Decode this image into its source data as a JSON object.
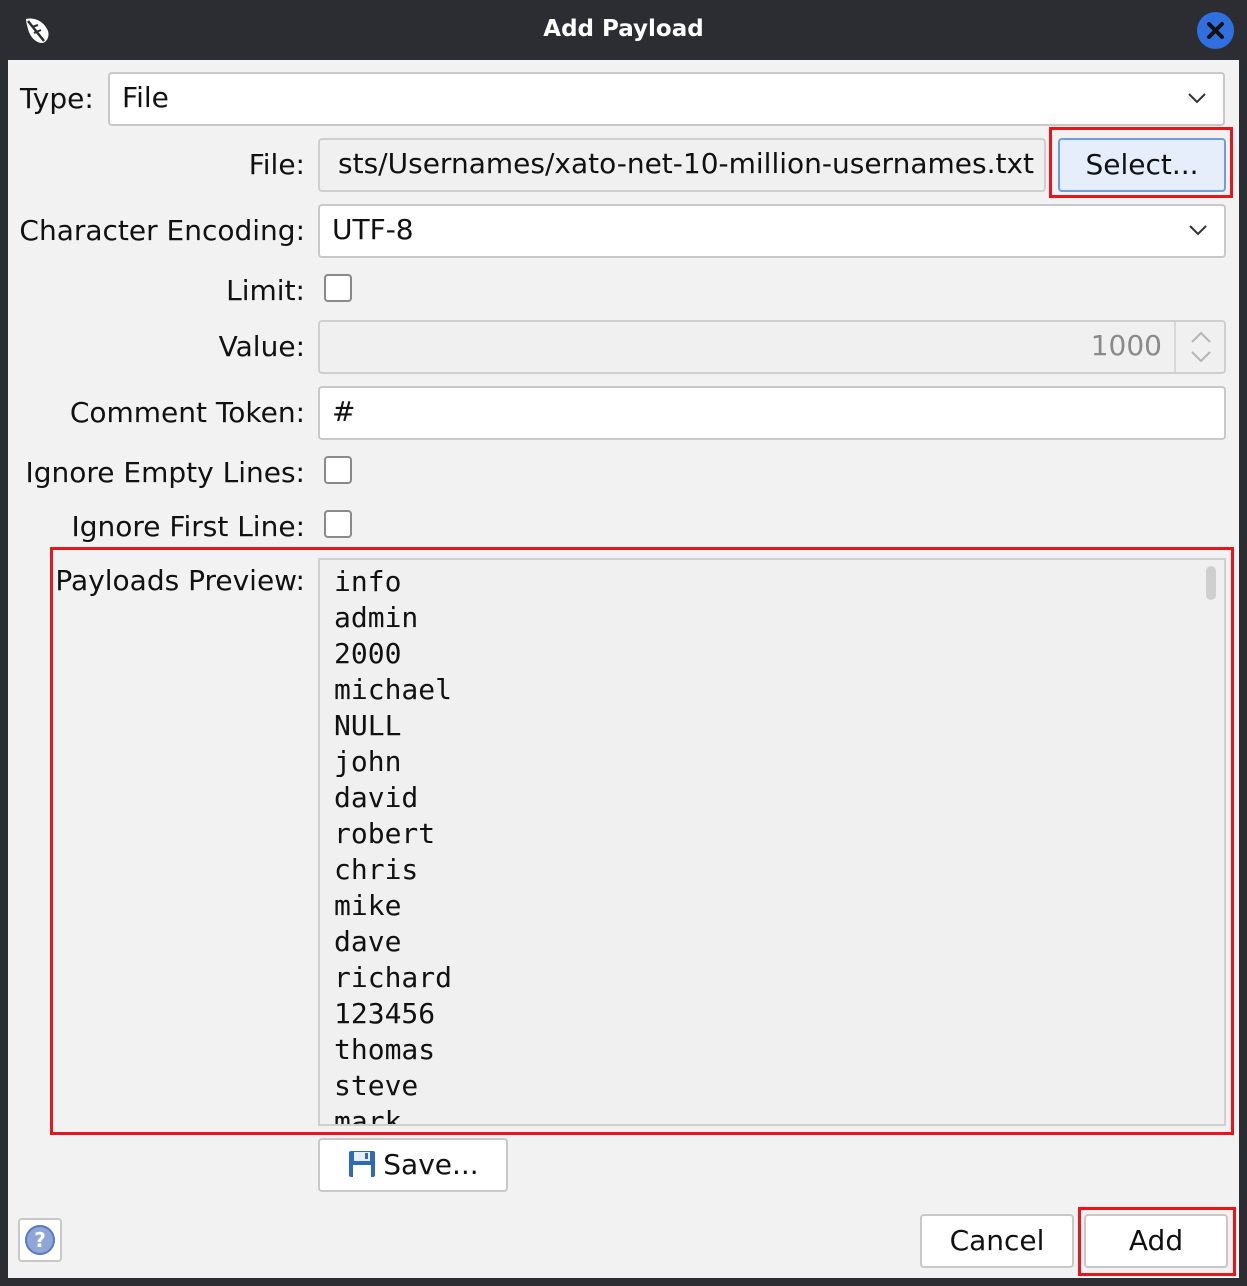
{
  "window": {
    "title": "Add Payload"
  },
  "icons": {
    "app": "app-feather-icon",
    "close": "close-icon",
    "chevron": "chevron-down-icon",
    "save": "floppy-disk-icon",
    "help": "help-icon",
    "spinner": "spinner-arrows-icon"
  },
  "form": {
    "type_label": "Type:",
    "type_value": "File",
    "file_label": "File:",
    "file_value": "sts/Usernames/xato-net-10-million-usernames.txt",
    "select_button": "Select...",
    "encoding_label": "Character Encoding:",
    "encoding_value": "UTF-8",
    "limit_label": "Limit:",
    "limit_checked": false,
    "value_label": "Value:",
    "value_value": "1000",
    "comment_label": "Comment Token:",
    "comment_value": "#",
    "ignore_empty_label": "Ignore Empty Lines:",
    "ignore_empty_checked": false,
    "ignore_first_label": "Ignore First Line:",
    "ignore_first_checked": false,
    "preview_label": "Payloads Preview:",
    "preview_items": [
      "info",
      "admin",
      "2000",
      "michael",
      "NULL",
      "john",
      "david",
      "robert",
      "chris",
      "mike",
      "dave",
      "richard",
      "123456",
      "thomas",
      "steve",
      "mark"
    ],
    "save_button": "Save..."
  },
  "footer": {
    "cancel_button": "Cancel",
    "add_button": "Add"
  },
  "colors": {
    "highlight": "#e8141e",
    "close_button": "#2f6fe0",
    "select_button_bg": "#e6eefb",
    "select_button_border": "#6f9ee0"
  }
}
